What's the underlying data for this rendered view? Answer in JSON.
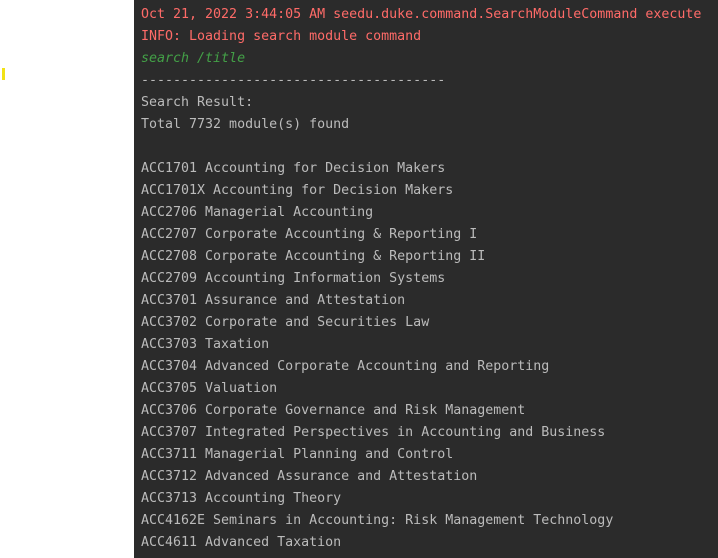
{
  "console": {
    "log_line_1": "Oct 21, 2022 3:44:05 AM seedu.duke.command.SearchModuleCommand execute",
    "log_line_2": "INFO: Loading search module command",
    "user_input": "search /title",
    "separator": "--------------------------------------",
    "result_header": "Search Result:",
    "result_count": "Total 7732 module(s) found",
    "modules": [
      "ACC1701 Accounting for Decision Makers",
      "ACC1701X Accounting for Decision Makers",
      "ACC2706 Managerial Accounting",
      "ACC2707 Corporate Accounting & Reporting I",
      "ACC2708 Corporate Accounting & Reporting II",
      "ACC2709 Accounting Information Systems",
      "ACC3701 Assurance and Attestation",
      "ACC3702 Corporate and Securities Law",
      "ACC3703 Taxation",
      "ACC3704 Advanced Corporate Accounting and Reporting",
      "ACC3705 Valuation",
      "ACC3706 Corporate Governance and Risk Management",
      "ACC3707 Integrated Perspectives in Accounting and Business",
      "ACC3711 Managerial Planning and Control",
      "ACC3712 Advanced Assurance and Attestation",
      "ACC3713 Accounting Theory",
      "ACC4162E Seminars in Accounting: Risk Management Technology",
      "ACC4611 Advanced Taxation"
    ]
  },
  "colors": {
    "console_background": "#2b2b2b",
    "log_text": "#ff6b68",
    "user_input_text": "#43a047",
    "output_text": "#bbbbbb",
    "gutter_marker": "#f2e216"
  }
}
